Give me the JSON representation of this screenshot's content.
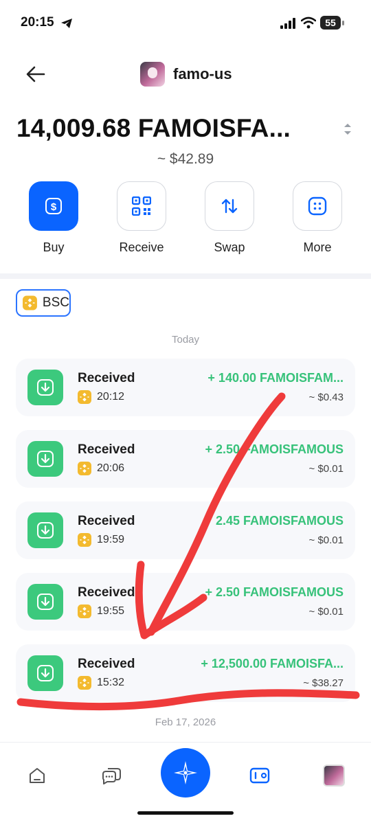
{
  "status_bar": {
    "time": "20:15",
    "battery": "55"
  },
  "header": {
    "token_name": "famo-us"
  },
  "balance": {
    "amount": "14,009.68 FAMOISFA...",
    "usd": "~ $42.89"
  },
  "actions": [
    {
      "label": "Buy",
      "icon": "dollar-icon"
    },
    {
      "label": "Receive",
      "icon": "qr-code-icon"
    },
    {
      "label": "Swap",
      "icon": "swap-arrows-icon"
    },
    {
      "label": "More",
      "icon": "more-dots-icon"
    }
  ],
  "chain_filter": {
    "label": "BSC",
    "icon": "bnb-icon"
  },
  "sections": [
    {
      "date": "Today"
    },
    {
      "date": "Feb 17, 2026"
    }
  ],
  "transactions": [
    {
      "type": "Received",
      "time": "20:12",
      "amount": "+ 140.00 FAMOISFAM...",
      "usd": "~ $0.43"
    },
    {
      "type": "Received",
      "time": "20:06",
      "amount": "+ 2.50 FAMOISFAMOUS",
      "usd": "~ $0.01"
    },
    {
      "type": "Received",
      "time": "19:59",
      "amount": "2.45 FAMOISFAMOUS",
      "usd": "~ $0.01"
    },
    {
      "type": "Received",
      "time": "19:55",
      "amount": "+ 2.50 FAMOISFAMOUS",
      "usd": "~ $0.01"
    },
    {
      "type": "Received",
      "time": "15:32",
      "amount": "+ 12,500.00 FAMOISFA...",
      "usd": "~ $38.27"
    }
  ],
  "bottom_nav": [
    "home-icon",
    "chat-icon",
    "trust-logo-icon",
    "wallet-icon",
    "profile-avatar"
  ],
  "colors": {
    "accent": "#0a64ff",
    "positive": "#37c27a",
    "annotation": "#ef3b3b",
    "bnb": "#f3ba2f"
  }
}
